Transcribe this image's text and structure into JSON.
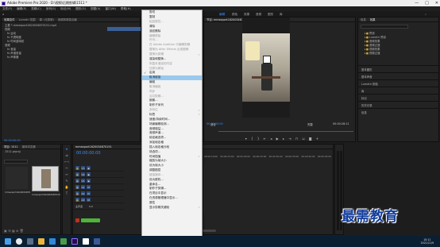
{
  "title": "Adobe Premiere Pro 2020 - D:\\视频\\后期剪辑\\1511 *",
  "window_buttons": [
    "—",
    "□",
    "✕"
  ],
  "menubar": [
    "文件(F)",
    "编辑(E)",
    "剪辑(C)",
    "序列(S)",
    "标记(M)",
    "图形(G)",
    "视图(V)",
    "窗口(W)",
    "帮助(H)"
  ],
  "workspace_tabs": [
    "主页",
    "学习",
    "组件",
    "编辑",
    "颜色",
    "效果",
    "音频",
    "图形",
    "库"
  ],
  "active_workspace": "编辑",
  "left_panel": {
    "tabs": [
      "效果控件",
      "Lumetri 范围",
      "源: (无剪辑)",
      "音频剪辑混合器"
    ],
    "header": "主要 * mmexport1620034870151.mp4",
    "rows": [
      "视频",
      "fx 运动",
      "fx 不透明度",
      "fx 时间重映射",
      "音频",
      "fx 音量",
      "fx 声道音量",
      "fx 声像器"
    ],
    "timecode": "00:00:00:00"
  },
  "menu": {
    "items": [
      {
        "label": "剪切",
        "state": "normal"
      },
      {
        "label": "复制",
        "state": "normal"
      },
      {
        "label": "粘贴属性...",
        "state": "dis"
      },
      {
        "label": "清除",
        "state": "normal"
      },
      {
        "label": "波纹删除",
        "state": "normal"
      },
      {
        "label": "编辑原始",
        "state": "dis"
      },
      {
        "label": "许可...",
        "state": "dis"
      },
      {
        "label": "在 Adobe Audition 中编辑剪辑",
        "state": "dis"
      },
      {
        "label": "替换为 After Effects 合成图像",
        "state": "dis"
      },
      {
        "label": "替换为剪辑",
        "state": "dis",
        "sub": true
      },
      {
        "label": "渲染和替换...",
        "state": "normal"
      },
      {
        "label": "恢复未渲染的内容",
        "state": "dis"
      },
      {
        "label": "还原为原始",
        "state": "dis"
      },
      {
        "label": "启用",
        "state": "normal",
        "check": true
      },
      {
        "label": "取消链接",
        "state": "hl"
      },
      {
        "label": "编组",
        "state": "normal"
      },
      {
        "label": "取消编组",
        "state": "dis"
      },
      {
        "label": "同步",
        "state": "dis"
      },
      {
        "label": "合并剪辑...",
        "state": "dis"
      },
      {
        "label": "嵌套...",
        "state": "normal"
      },
      {
        "label": "制作子序列",
        "state": "normal"
      },
      {
        "label": "多机位",
        "state": "dis",
        "sub": true
      },
      {
        "label": "标签",
        "state": "normal",
        "sub": true
      },
      {
        "label": "速度/持续时间...",
        "state": "normal"
      },
      {
        "label": "场景编辑检测...",
        "state": "normal"
      },
      {
        "label": "音频增益...",
        "state": "normal"
      },
      {
        "label": "音频声道...",
        "state": "normal"
      },
      {
        "label": "帧定格选项...",
        "state": "normal"
      },
      {
        "label": "添加帧定格",
        "state": "normal"
      },
      {
        "label": "插入帧定格分段",
        "state": "normal"
      },
      {
        "label": "场选项...",
        "state": "normal"
      },
      {
        "label": "时间插值",
        "state": "normal",
        "sub": true
      },
      {
        "label": "缩放为帧大小",
        "state": "normal"
      },
      {
        "label": "设为帧大小",
        "state": "normal"
      },
      {
        "label": "调整图层",
        "state": "normal"
      },
      {
        "label": "链接媒体...",
        "state": "dis"
      },
      {
        "label": "设为脱机...",
        "state": "normal"
      },
      {
        "label": "重命名...",
        "state": "normal"
      },
      {
        "label": "制作子剪辑...",
        "state": "normal"
      },
      {
        "label": "在项目中显示",
        "state": "normal"
      },
      {
        "label": "在资源管理器中显示...",
        "state": "normal"
      },
      {
        "label": "属性",
        "state": "normal"
      },
      {
        "label": "显示剪辑关键帧",
        "state": "normal",
        "sub": true
      }
    ]
  },
  "program_monitor": {
    "tab": "节目: mmexport1620034870151",
    "left_timecode": "00:00:00:00",
    "fit_label": "适合",
    "quality_label": "完整",
    "end_timecode": "00:00:28:11"
  },
  "project_panel": {
    "tabs": [
      "项目: 1511",
      "媒体浏览器"
    ],
    "file_name": "1511.prproj",
    "clip_label": "mmexport1620034870151",
    "clip2_label": "mmexport1620034870151"
  },
  "timeline": {
    "tab": "mmexport1620034870151",
    "timecode": "00:00:00:00",
    "ruler": [
      "00:00",
      "00:00:05:00",
      "00:00:10:00",
      "00:00:15:00",
      "00:00:20:00",
      "00:00:25:00",
      "00:00:30:00",
      "00:00:35:00",
      "00:00:40:00",
      "00:00:45:00"
    ],
    "tracks": [
      "V3",
      "V2",
      "V1",
      "A1",
      "A2",
      "A3",
      "主声道"
    ],
    "master_value": "0.0"
  },
  "right_panel": {
    "tabs": [
      "信息",
      "效果"
    ],
    "tree": [
      "预设",
      "Lumetri 预设",
      "音频效果",
      "音频过渡",
      "视频效果",
      "视频过渡"
    ],
    "sections": [
      "基本图形",
      "基本声音",
      "Lumetri 颜色",
      "库",
      "标记",
      "历史记录",
      "信息"
    ]
  },
  "taskbar": {
    "time": "10:11",
    "date": "2021/11/9"
  },
  "watermark": "最需教育",
  "colors": {
    "accent": "#3a8bff",
    "menu_highlight": "#99c9ef",
    "clip_green": "#4fb33b",
    "taskbar": "#0b1f33"
  }
}
